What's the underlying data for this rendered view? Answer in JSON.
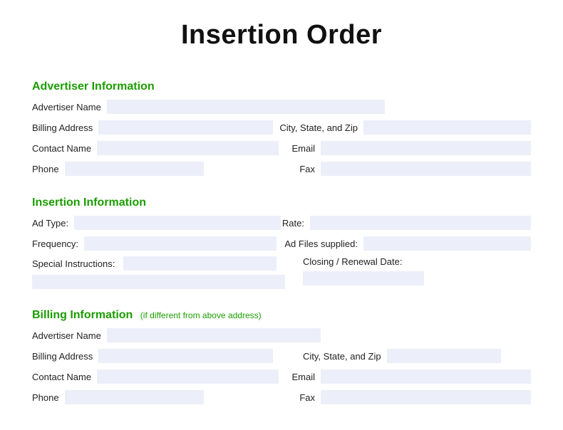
{
  "title": "Insertion Order",
  "sections": {
    "advertiser": {
      "heading": "Advertiser Information",
      "fields": {
        "advertiser_name": "Advertiser Name",
        "billing_address": "Billing Address",
        "city_state_zip": "City, State, and Zip",
        "contact_name": "Contact Name",
        "email": "Email",
        "phone": "Phone",
        "fax": "Fax"
      }
    },
    "insertion": {
      "heading": "Insertion Information",
      "fields": {
        "ad_type": "Ad Type:",
        "rate": "Rate:",
        "frequency": "Frequency:",
        "ad_files_supplied": "Ad Files supplied:",
        "special_instructions": "Special Instructions:",
        "closing_date": "Closing / Renewal Date:"
      }
    },
    "billing": {
      "heading": "Billing Information",
      "note": "(if different from above address)",
      "fields": {
        "advertiser_name": "Advertiser Name",
        "billing_address": "Billing Address",
        "city_state_zip": "City, State, and Zip",
        "contact_name": "Contact Name",
        "email": "Email",
        "phone": "Phone",
        "fax": "Fax"
      }
    }
  }
}
